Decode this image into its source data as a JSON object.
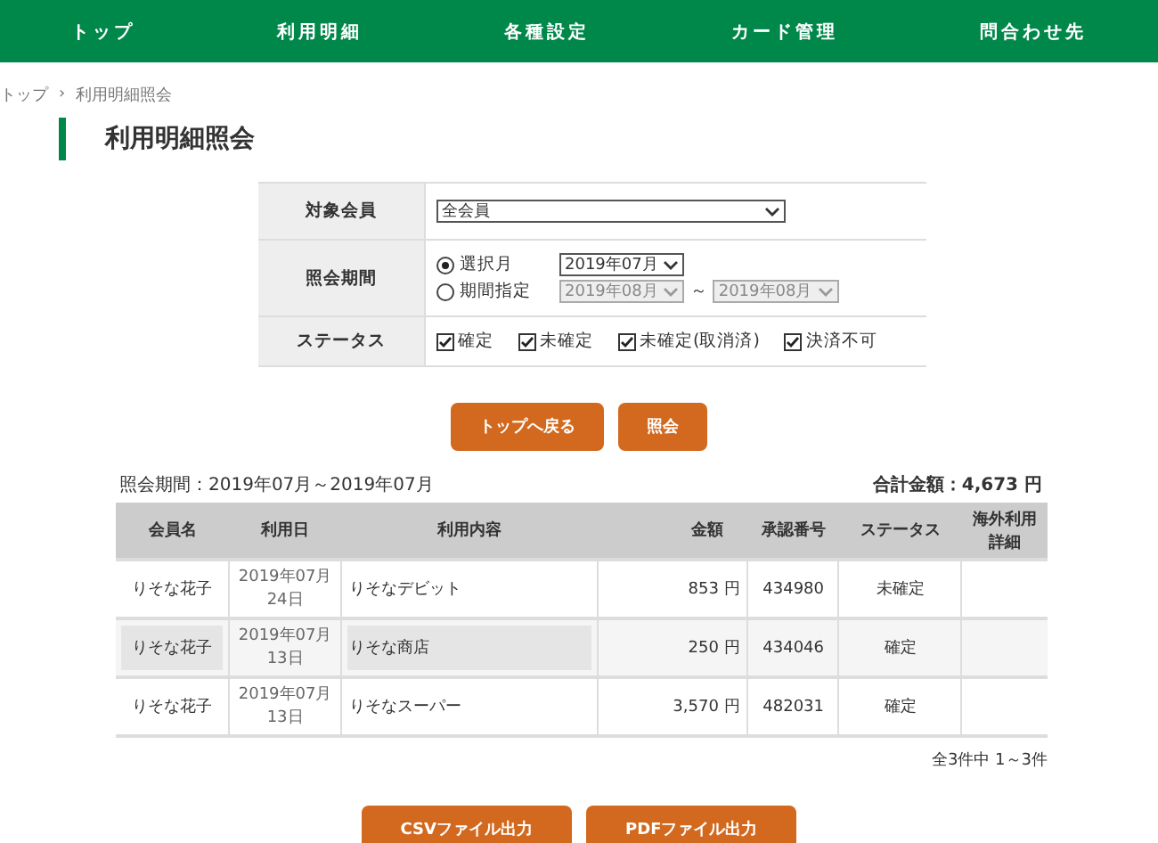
{
  "nav": [
    {
      "label": "トップ"
    },
    {
      "label": "利用明細"
    },
    {
      "label": "各種設定"
    },
    {
      "label": "カード管理"
    },
    {
      "label": "問合わせ先"
    }
  ],
  "breadcrumb": [
    "トップ",
    "利用明細照会"
  ],
  "breadcrumb_separator": "›",
  "title": "利用明細照会",
  "form": {
    "member": {
      "label": "対象会員",
      "value": "全会員"
    },
    "period": {
      "label": "照会期間",
      "options": [
        {
          "label": "選択月",
          "selected": true,
          "selects": [
            {
              "value": "2019年07月",
              "disabled": false
            }
          ]
        },
        {
          "label": "期間指定",
          "selected": false,
          "selects": [
            {
              "value": "2019年08月",
              "disabled": true
            },
            {
              "value": "2019年08月",
              "disabled": true
            }
          ]
        }
      ],
      "range_separator": "～"
    },
    "status": {
      "label": "ステータス",
      "options": [
        {
          "label": "確定",
          "checked": true
        },
        {
          "label": "未確定",
          "checked": true
        },
        {
          "label": "未確定(取消済)",
          "checked": true
        },
        {
          "label": "決済不可",
          "checked": true
        }
      ]
    }
  },
  "actions": [
    "トップへ戻る",
    "照会"
  ],
  "summary": {
    "period": "照会期間：2019年07月～2019年07月",
    "total": "合計金額：4,673 円"
  },
  "table": {
    "columns": [
      "会員名",
      "利用日",
      "利用内容",
      "金額",
      "承認番号",
      "ステータス",
      "海外利用詳細"
    ],
    "rows": [
      {
        "member": "りそな花子",
        "date": "2019年07月24日",
        "description": "りそなデビット",
        "amount": "853 円",
        "approval": "434980",
        "status": "未確定",
        "selected": false
      },
      {
        "member": "りそな花子",
        "date": "2019年07月13日",
        "description": "りそな商店",
        "amount": "250 円",
        "approval": "434046",
        "status": "確定",
        "selected": true
      },
      {
        "member": "りそな花子",
        "date": "2019年07月13日",
        "description": "りそなスーパー",
        "amount": "3,570 円",
        "approval": "482031",
        "status": "確定",
        "selected": false
      }
    ]
  },
  "pagination": "全3件中 1～3件",
  "exports": [
    "CSVファイル出力",
    "PDFファイル出力"
  ]
}
